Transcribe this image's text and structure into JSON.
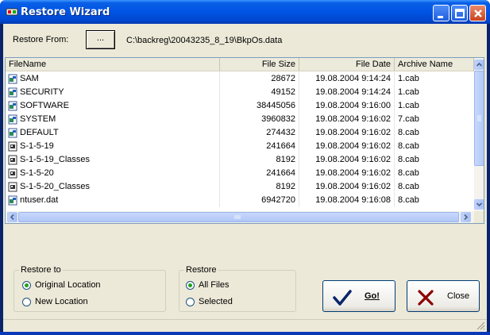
{
  "window": {
    "title": "Restore Wizard"
  },
  "restore_from": {
    "label": "Restore From:",
    "browse_label": "...",
    "path": "C:\\backreg\\20043235_8_19\\BkpOs.data"
  },
  "file_list": {
    "columns": [
      "FileName",
      "File Size",
      "File Date",
      "Archive Name"
    ],
    "rows": [
      {
        "name": "SAM",
        "size": "28672",
        "date": "19.08.2004 9:14:24",
        "archive": "1.cab",
        "icon": "registry-file-icon"
      },
      {
        "name": "SECURITY",
        "size": "49152",
        "date": "19.08.2004 9:14:24",
        "archive": "1.cab",
        "icon": "registry-file-icon"
      },
      {
        "name": "SOFTWARE",
        "size": "38445056",
        "date": "19.08.2004 9:16:00",
        "archive": "1.cab",
        "icon": "registry-file-icon"
      },
      {
        "name": "SYSTEM",
        "size": "3960832",
        "date": "19.08.2004 9:16:02",
        "archive": "7.cab",
        "icon": "registry-file-icon"
      },
      {
        "name": "DEFAULT",
        "size": "274432",
        "date": "19.08.2004 9:16:02",
        "archive": "8.cab",
        "icon": "registry-file-icon"
      },
      {
        "name": "S-1-5-19",
        "size": "241664",
        "date": "19.08.2004 9:16:02",
        "archive": "8.cab",
        "icon": "user-hive-icon"
      },
      {
        "name": "S-1-5-19_Classes",
        "size": "8192",
        "date": "19.08.2004 9:16:02",
        "archive": "8.cab",
        "icon": "user-hive-icon"
      },
      {
        "name": "S-1-5-20",
        "size": "241664",
        "date": "19.08.2004 9:16:02",
        "archive": "8.cab",
        "icon": "user-hive-icon"
      },
      {
        "name": "S-1-5-20_Classes",
        "size": "8192",
        "date": "19.08.2004 9:16:02",
        "archive": "8.cab",
        "icon": "user-hive-icon"
      },
      {
        "name": "ntuser.dat",
        "size": "6942720",
        "date": "19.08.2004 9:16:08",
        "archive": "8.cab",
        "icon": "registry-file-icon"
      }
    ]
  },
  "restore_to": {
    "title": "Restore to",
    "options": [
      {
        "label": "Original Location",
        "selected": true
      },
      {
        "label": "New Location",
        "selected": false
      }
    ]
  },
  "restore": {
    "title": "Restore",
    "options": [
      {
        "label": "All Files",
        "selected": true
      },
      {
        "label": "Selected",
        "selected": false
      }
    ]
  },
  "actions": {
    "go_label": "Go!",
    "close_label": "Close"
  },
  "colors": {
    "titlebar": "#0054e3",
    "dialog_bg": "#ece9d8",
    "go_check": "#0a246a",
    "close_x": "#8b0000"
  }
}
